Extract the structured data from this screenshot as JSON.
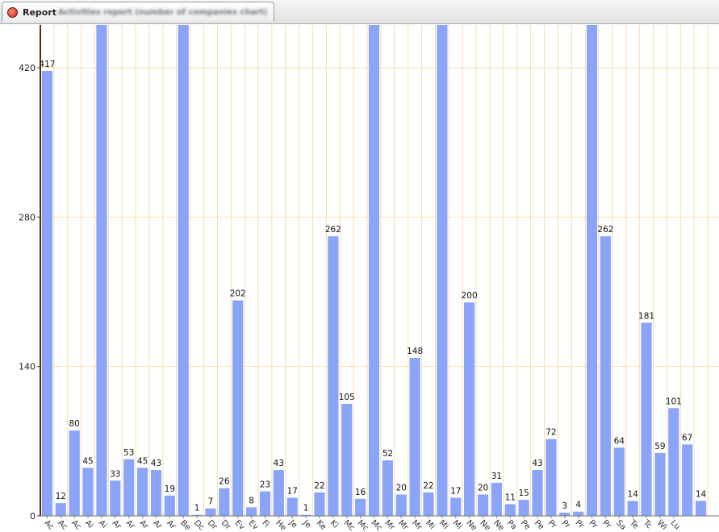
{
  "tab": {
    "label": "Report",
    "subtitle": "Activities report (number of companies chart)"
  },
  "chart_data": {
    "type": "bar",
    "title": "Activities report (number of companies chart)",
    "xlabel": "",
    "ylabel": "",
    "ylim": [
      0,
      460
    ],
    "yticks": [
      0,
      140,
      280,
      420
    ],
    "grid": true,
    "colors": {
      "bar": "#8aa4f7",
      "grid": "#f6dfa8",
      "axis": "#5a2a10"
    },
    "categories": [
      "Ac",
      "Ac",
      "Ac",
      "Ai",
      "Ai",
      "Ar",
      "Ar",
      "Ar",
      "Ar",
      "Ar",
      "Be",
      "Dc",
      "Dr",
      "Dr",
      "Ev",
      "Ev",
      "Fi",
      "He",
      "Je",
      "Je",
      "Ke",
      "Ki",
      "Mc",
      "Mc",
      "Mc",
      "Mr",
      "Mr",
      "Mr",
      "Mi",
      "Mi",
      "Mi",
      "Ne",
      "Ne",
      "Ne",
      "Pa",
      "Pe",
      "Pe",
      "Pr",
      "Pr",
      "Pr",
      "Pr",
      "Pr",
      "Sa",
      "Te",
      "Tc",
      "Wi",
      "Lu"
    ],
    "values": [
      417,
      12,
      80,
      45,
      460,
      33,
      53,
      45,
      43,
      19,
      460,
      1,
      7,
      26,
      202,
      8,
      23,
      43,
      17,
      1,
      22,
      262,
      105,
      16,
      460,
      52,
      20,
      148,
      22,
      460,
      17,
      200,
      20,
      31,
      11,
      15,
      43,
      72,
      3,
      4,
      460,
      262,
      64,
      14,
      181,
      59,
      101,
      67,
      14
    ],
    "labels": [
      "417",
      "12",
      "80",
      "45",
      "",
      "33",
      "53",
      "45",
      "43",
      "19",
      "",
      "1",
      "7",
      "26",
      "202",
      "8",
      "23",
      "43",
      "17",
      "1",
      "22",
      "262",
      "105",
      "16",
      "",
      "52",
      "20",
      "148",
      "22",
      "",
      "17",
      "200",
      "20",
      "31",
      "11",
      "15",
      "43",
      "72",
      "3",
      "4",
      "",
      "262",
      "64",
      "14",
      "181",
      "59",
      "101",
      "67",
      "14"
    ]
  }
}
